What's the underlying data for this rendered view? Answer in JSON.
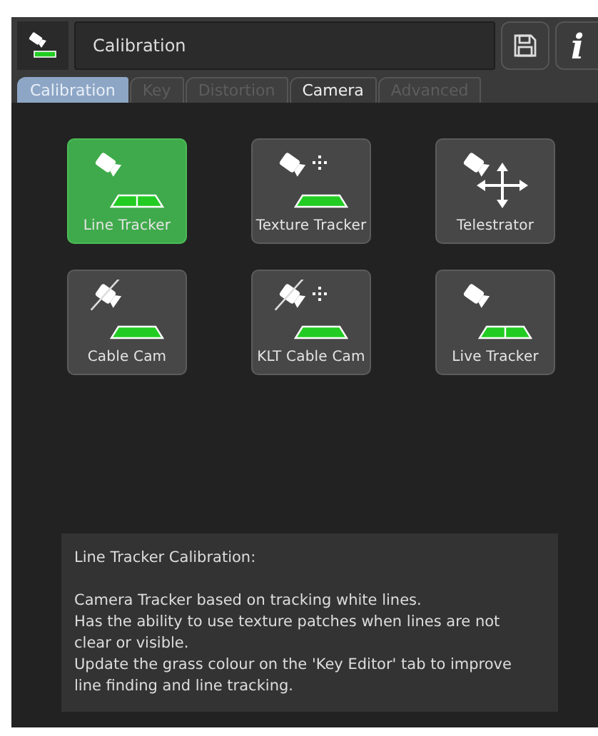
{
  "header": {
    "title": "Calibration",
    "info_label": "i"
  },
  "tabs": [
    {
      "label": "Calibration",
      "selected": true,
      "disabled": false
    },
    {
      "label": "Key",
      "selected": false,
      "disabled": true
    },
    {
      "label": "Distortion",
      "selected": false,
      "disabled": true
    },
    {
      "label": "Camera",
      "selected": false,
      "disabled": false
    },
    {
      "label": "Advanced",
      "selected": false,
      "disabled": true
    }
  ],
  "tiles": [
    {
      "label": "Line Tracker",
      "kind": "line",
      "selected": true
    },
    {
      "label": "Texture Tracker",
      "kind": "texture",
      "selected": false
    },
    {
      "label": "Telestrator",
      "kind": "telestrator",
      "selected": false
    },
    {
      "label": "Cable Cam",
      "kind": "cable",
      "selected": false
    },
    {
      "label": "KLT Cable Cam",
      "kind": "klt_cable",
      "selected": false
    },
    {
      "label": "Live Tracker",
      "kind": "line",
      "selected": false
    }
  ],
  "description": {
    "title": "Line Tracker Calibration:",
    "paragraphs": [
      "Camera Tracker based on tracking white lines.",
      "Has the ability to use texture patches when lines are not clear or visible.",
      "Update the grass colour on the 'Key Editor' tab to improve line finding and line tracking."
    ]
  }
}
